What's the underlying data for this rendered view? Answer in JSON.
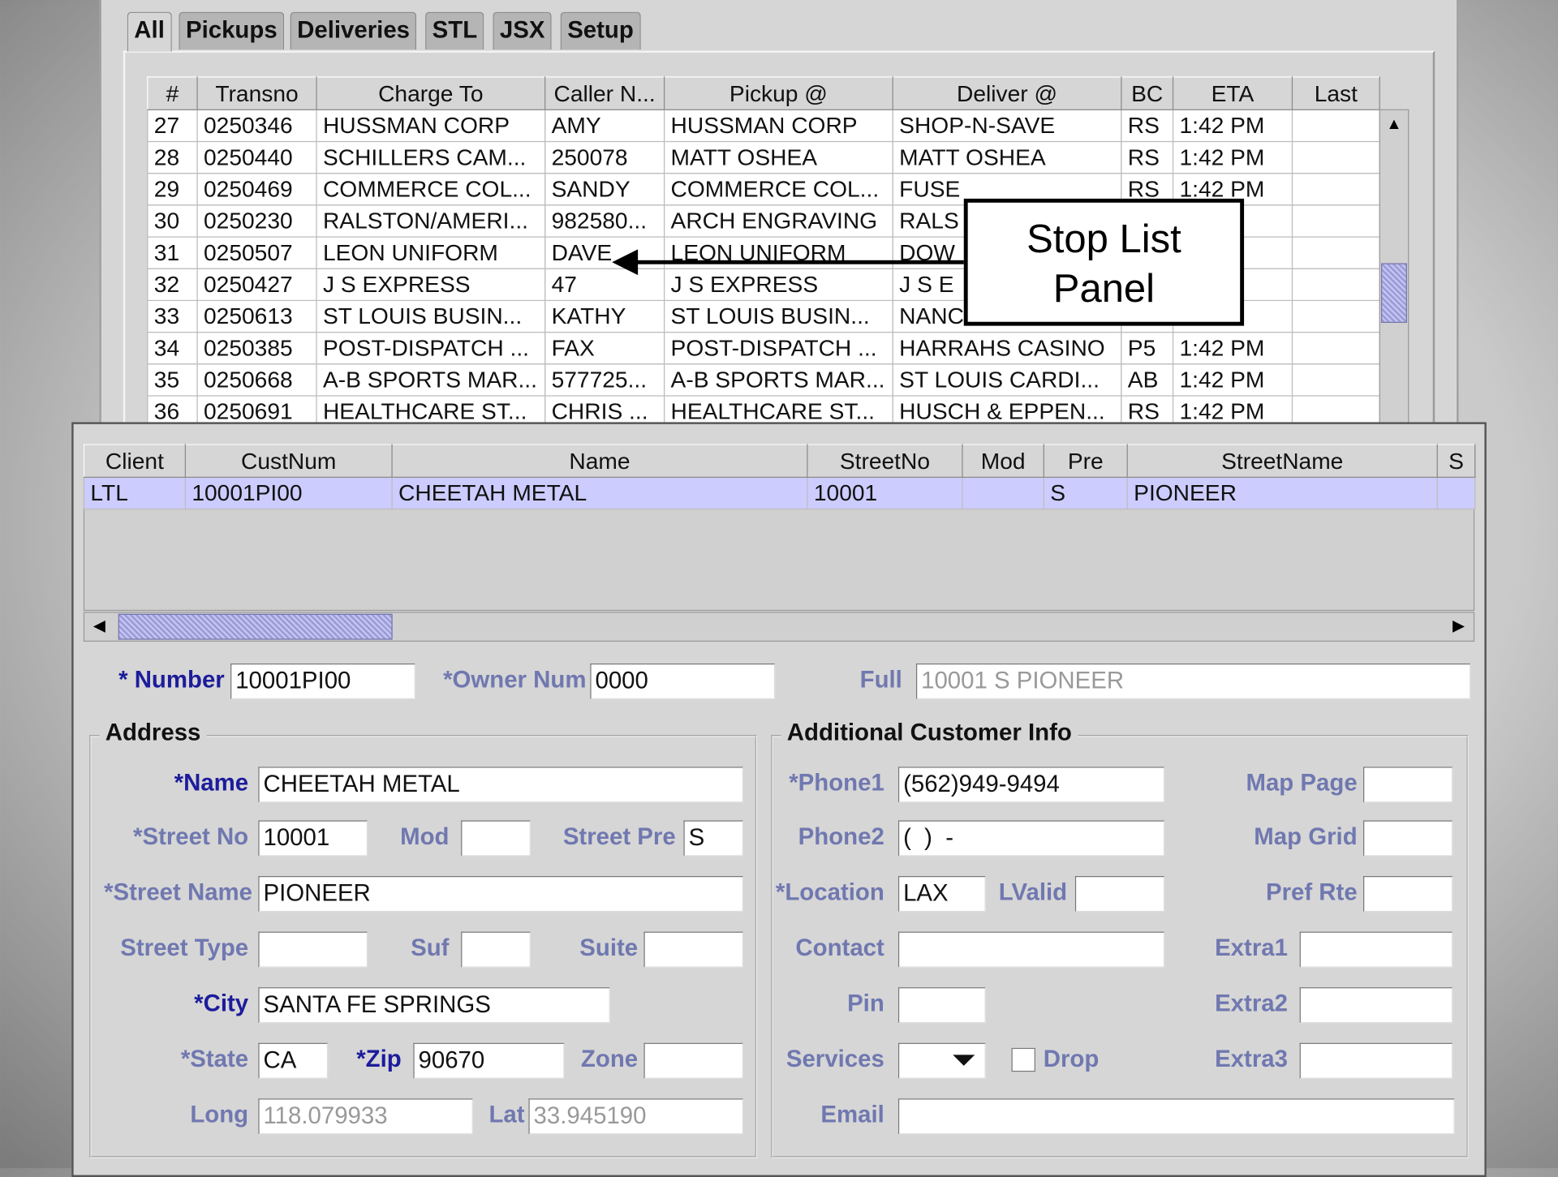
{
  "tabs": [
    "All",
    "Pickups",
    "Deliveries",
    "STL",
    "JSX",
    "Setup"
  ],
  "stop_list": {
    "columns": [
      "#",
      "Transno",
      "Charge To",
      "Caller N...",
      "Pickup @",
      "Deliver @",
      "BC",
      "ETA",
      "Last"
    ],
    "rows": [
      [
        "27",
        "0250346",
        "HUSSMAN CORP",
        "AMY",
        "HUSSMAN CORP",
        "SHOP-N-SAVE",
        "RS",
        "1:42 PM",
        ""
      ],
      [
        "28",
        "0250440",
        "SCHILLERS CAM...",
        "250078",
        "MATT OSHEA",
        "MATT OSHEA",
        "RS",
        "1:42 PM",
        ""
      ],
      [
        "29",
        "0250469",
        "COMMERCE COL...",
        "SANDY",
        "COMMERCE COL...",
        "FUSE",
        "RS",
        "1:42 PM",
        ""
      ],
      [
        "30",
        "0250230",
        "RALSTON/AMERI...",
        "982580...",
        "ARCH ENGRAVING",
        "RALS",
        "",
        "PM",
        ""
      ],
      [
        "31",
        "0250507",
        "LEON UNIFORM",
        "DAVE",
        "LEON UNIFORM",
        "DOW",
        "",
        "PM",
        ""
      ],
      [
        "32",
        "0250427",
        "J S EXPRESS",
        "47",
        "J S EXPRESS",
        "J S E",
        "",
        "PM",
        ""
      ],
      [
        "33",
        "0250613",
        "ST LOUIS BUSIN...",
        "KATHY",
        "ST LOUIS BUSIN...",
        "NANC",
        "",
        "PM",
        ""
      ],
      [
        "34",
        "0250385",
        "POST-DISPATCH ...",
        "FAX",
        "POST-DISPATCH ...",
        "HARRAHS CASINO",
        "P5",
        "1:42 PM",
        ""
      ],
      [
        "35",
        "0250668",
        "A-B SPORTS MAR...",
        "577725...",
        "A-B SPORTS MAR...",
        "ST LOUIS CARDI...",
        "AB",
        "1:42 PM",
        ""
      ],
      [
        "36",
        "0250691",
        "HEALTHCARE ST...",
        "CHRIS ...",
        "HEALTHCARE ST...",
        "HUSCH & EPPEN...",
        "RS",
        "1:42 PM",
        ""
      ]
    ]
  },
  "callout": {
    "line1": "Stop List",
    "line2": "Panel"
  },
  "customer_list": {
    "columns": [
      "Client",
      "CustNum",
      "Name",
      "StreetNo",
      "Mod",
      "Pre",
      "StreetName",
      "S"
    ],
    "rows": [
      [
        "LTL",
        "10001PI00",
        "CHEETAH METAL",
        "10001",
        "",
        "S",
        "PIONEER",
        ""
      ]
    ]
  },
  "form": {
    "number": {
      "label": "* Number",
      "value": "10001PI00"
    },
    "owner_num": {
      "label": "*Owner Num",
      "value": "0000"
    },
    "full": {
      "label": "Full",
      "value": "10001 S PIONEER"
    },
    "address": {
      "title": "Address",
      "name": {
        "label": "*Name",
        "value": "CHEETAH METAL"
      },
      "street_no": {
        "label": "*Street No",
        "value": "10001"
      },
      "mod": {
        "label": "Mod",
        "value": ""
      },
      "street_pre": {
        "label": "Street Pre",
        "value": "S"
      },
      "street_name": {
        "label": "*Street Name",
        "value": "PIONEER"
      },
      "street_type": {
        "label": "Street Type",
        "value": ""
      },
      "suf": {
        "label": "Suf",
        "value": ""
      },
      "suite": {
        "label": "Suite",
        "value": ""
      },
      "city": {
        "label": "*City",
        "value": "SANTA FE SPRINGS"
      },
      "state": {
        "label": "*State",
        "value": "CA"
      },
      "zip": {
        "label": "*Zip",
        "value": "90670"
      },
      "zone": {
        "label": "Zone",
        "value": ""
      },
      "long": {
        "label": "Long",
        "value": "118.079933"
      },
      "lat": {
        "label": "Lat",
        "value": "33.945190"
      }
    },
    "additional": {
      "title": "Additional Customer Info",
      "phone1": {
        "label": "*Phone1",
        "value": "(562)949-9494"
      },
      "phone2": {
        "label": "Phone2",
        "value": "(  )  -"
      },
      "location": {
        "label": "*Location",
        "value": "LAX"
      },
      "lvalid": {
        "label": "LValid",
        "value": ""
      },
      "contact": {
        "label": "Contact",
        "value": ""
      },
      "pin": {
        "label": "Pin",
        "value": ""
      },
      "services": {
        "label": "Services",
        "value": ""
      },
      "drop": {
        "label": "Drop",
        "checked": false
      },
      "email": {
        "label": "Email",
        "value": ""
      },
      "map_page": {
        "label": "Map Page",
        "value": ""
      },
      "map_grid": {
        "label": "Map Grid",
        "value": ""
      },
      "pref_rte": {
        "label": "Pref Rte",
        "value": ""
      },
      "extra1": {
        "label": "Extra1",
        "value": ""
      },
      "extra2": {
        "label": "Extra2",
        "value": ""
      },
      "extra3": {
        "label": "Extra3",
        "value": ""
      }
    }
  }
}
